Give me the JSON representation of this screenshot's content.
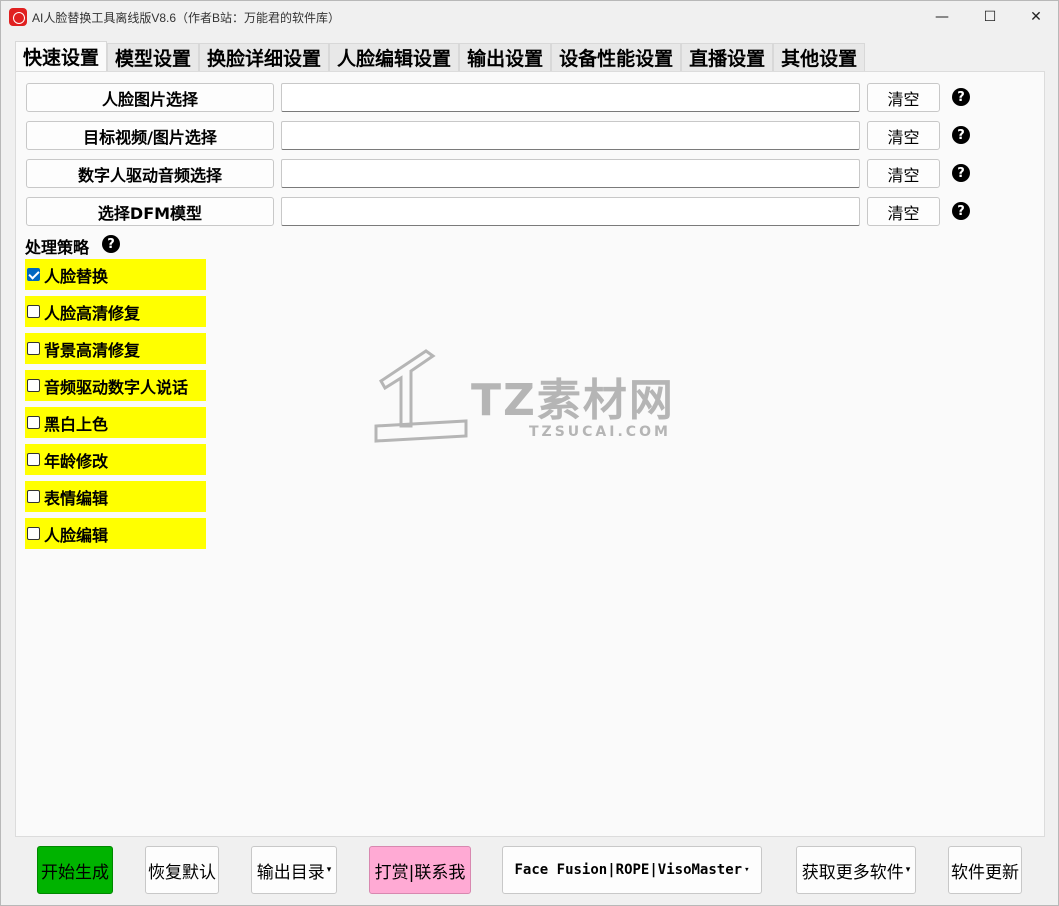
{
  "window": {
    "title": "AI人脸替换工具离线版V8.6（作者B站：万能君的软件库）",
    "minimize": "—",
    "maximize": "☐",
    "close": "✕"
  },
  "tabs": [
    {
      "label": "快速设置",
      "active": true
    },
    {
      "label": "模型设置"
    },
    {
      "label": "换脸详细设置"
    },
    {
      "label": "人脸编辑设置"
    },
    {
      "label": "输出设置"
    },
    {
      "label": "设备性能设置"
    },
    {
      "label": "直播设置"
    },
    {
      "label": "其他设置"
    }
  ],
  "file_rows": [
    {
      "button": "人脸图片选择",
      "value": "",
      "clear": "清空",
      "help": "?"
    },
    {
      "button": "目标视频/图片选择",
      "value": "",
      "clear": "清空",
      "help": "?"
    },
    {
      "button": "数字人驱动音频选择",
      "value": "",
      "clear": "清空",
      "help": "?"
    },
    {
      "button": "选择DFM模型",
      "value": "",
      "clear": "清空",
      "help": "?"
    }
  ],
  "strategy": {
    "label": "处理策略",
    "help": "?",
    "options": [
      {
        "label": "人脸替换",
        "checked": true
      },
      {
        "label": "人脸高清修复",
        "checked": false
      },
      {
        "label": "背景高清修复",
        "checked": false
      },
      {
        "label": "音频驱动数字人说话",
        "checked": false
      },
      {
        "label": "黑白上色",
        "checked": false
      },
      {
        "label": "年龄修改",
        "checked": false
      },
      {
        "label": "表情编辑",
        "checked": false
      },
      {
        "label": "人脸编辑",
        "checked": false
      }
    ]
  },
  "watermark": {
    "text": "TZ素材网",
    "sub": "TZSUCAI.COM"
  },
  "bottom": {
    "start": "开始生成",
    "reset": "恢复默认",
    "output_dir": "输出目录",
    "donate": "打赏|联系我",
    "engines": "Face Fusion|ROPE|VisoMaster",
    "more_software": "获取更多软件",
    "update": "软件更新",
    "caret": "▾"
  },
  "colors": {
    "option_bg": "#ffff00",
    "start_bg": "#00b300",
    "donate_bg": "#ffaad4",
    "checkbox_on": "#0067c0"
  }
}
